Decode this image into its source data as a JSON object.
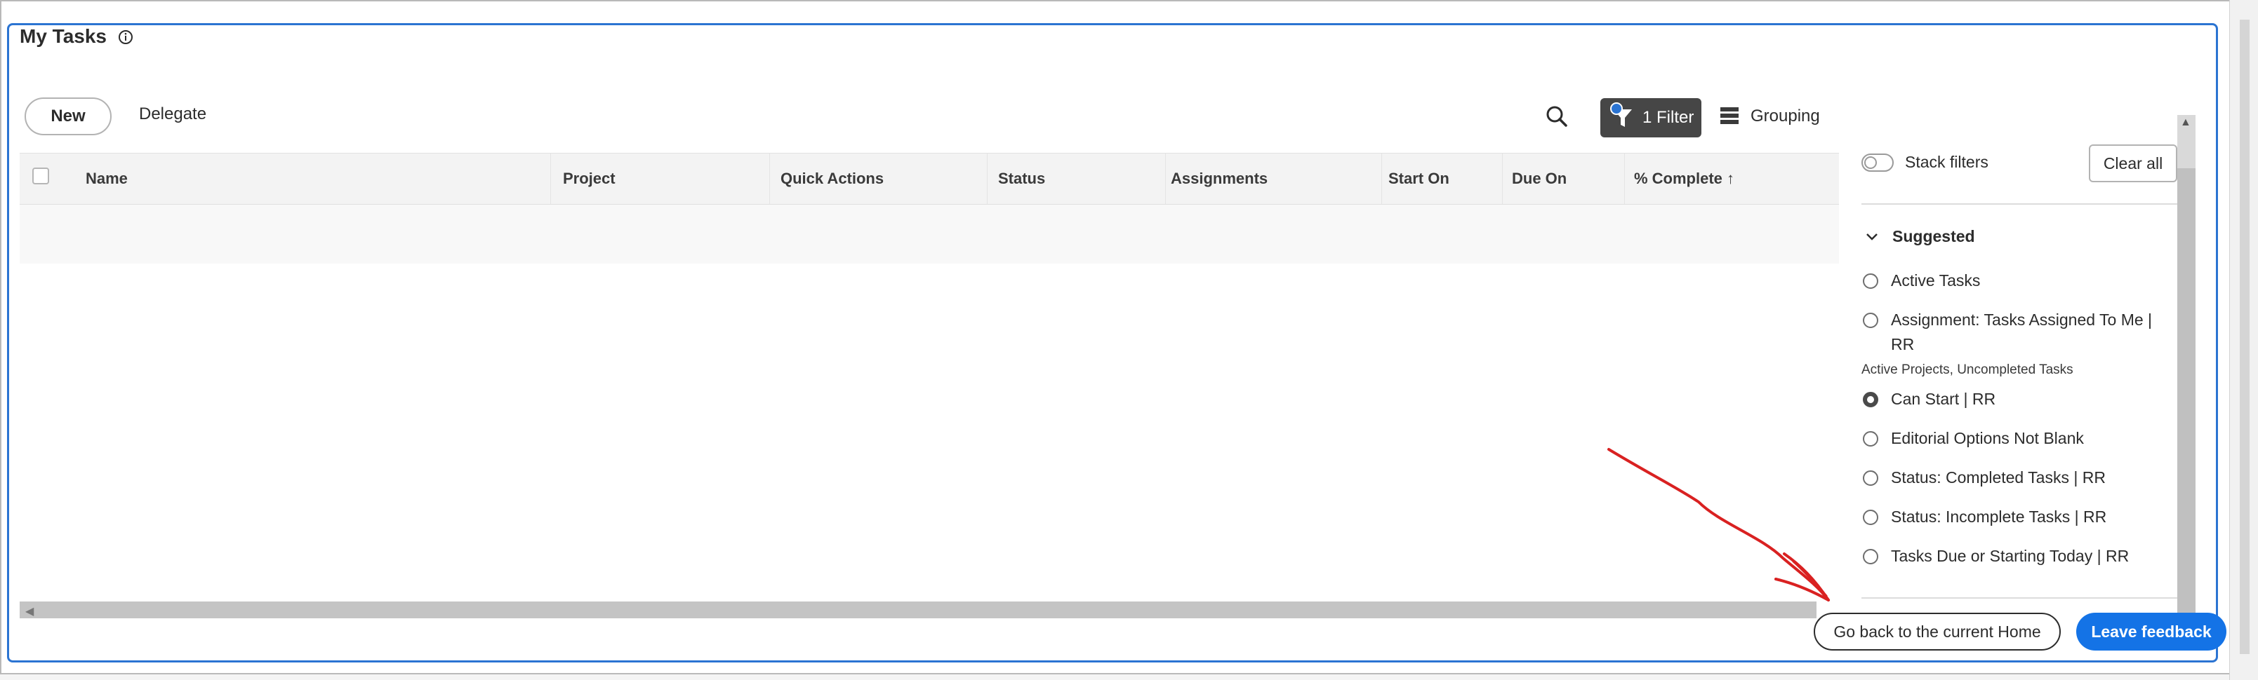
{
  "header": {
    "title": "My Tasks"
  },
  "toolbar": {
    "new_label": "New",
    "delegate_label": "Delegate",
    "filter_label": "1 Filter",
    "grouping_label": "Grouping"
  },
  "table": {
    "columns": [
      "Name",
      "Project",
      "Quick Actions",
      "Status",
      "Assignments",
      "Start On",
      "Due On",
      "% Complete ↑"
    ],
    "rows": []
  },
  "filter_panel": {
    "stack_filters_label": "Stack filters",
    "stack_filters_on": false,
    "clear_all_label": "Clear all",
    "section_title": "Suggested",
    "options": [
      {
        "label": "Active Tasks",
        "selected": false
      },
      {
        "label": "Assignment: Tasks Assigned To Me |",
        "label_line2": "RR",
        "selected": false
      },
      {
        "label": "Can Start | RR",
        "selected": true
      },
      {
        "label": "Editorial Options Not Blank",
        "selected": false
      },
      {
        "label": "Status: Completed Tasks | RR",
        "selected": false
      },
      {
        "label": "Status: Incomplete Tasks | RR",
        "selected": false
      },
      {
        "label": "Tasks Due or Starting Today | RR",
        "selected": false
      }
    ],
    "option_subtext": "Active Projects, Uncompleted Tasks"
  },
  "footer": {
    "home_label": "Go back to the current Home",
    "feedback_label": "Leave feedback"
  },
  "colors": {
    "accent": "#1473e6",
    "frame": "#2b74d2",
    "annotation": "#d92121"
  },
  "icons": [
    "info-icon",
    "search-icon",
    "filter-icon",
    "grouping-icon",
    "chevron-down-icon"
  ]
}
